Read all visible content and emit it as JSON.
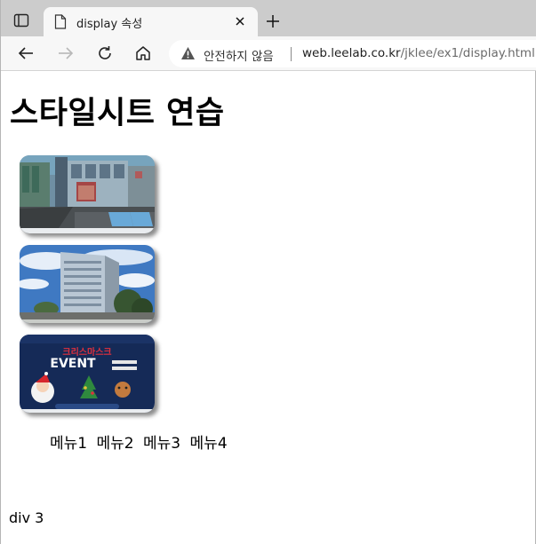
{
  "browser": {
    "tab_title": "display 속성",
    "address": {
      "security_text": "안전하지 않음",
      "host": "web.leelab.co.kr",
      "path": "/jklee/ex1/display.html"
    }
  },
  "page": {
    "title": "스타일시트 연습",
    "images": [
      {
        "alt": "building-entrance-photo"
      },
      {
        "alt": "office-tower-photo"
      },
      {
        "alt": "christmas-event-poster",
        "poster_title": "크리스마스크",
        "poster_event": "EVENT"
      }
    ],
    "menu": [
      "메뉴1",
      "메뉴2",
      "메뉴3",
      "메뉴4"
    ],
    "footer_div": "div 3"
  }
}
